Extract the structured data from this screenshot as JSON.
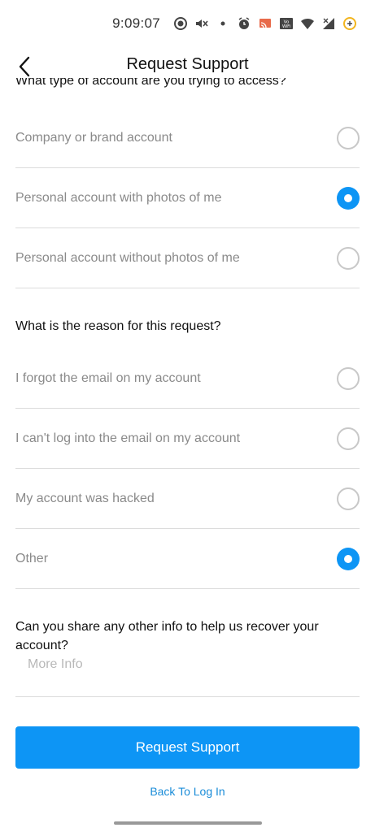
{
  "status_bar": {
    "time": "9:09:07",
    "icons": [
      "record-icon",
      "mute-icon",
      "dot-icon",
      "alarm-icon",
      "cast-icon",
      "vowifi-icon",
      "wifi-icon",
      "signal-icon",
      "battery-icon"
    ],
    "vowifi_text": "Vo WiFi"
  },
  "header": {
    "title": "Request Support"
  },
  "account_type": {
    "question": "What type of account are you trying to access?",
    "options": [
      {
        "label": "Company or brand account",
        "selected": false
      },
      {
        "label": "Personal account with photos of me",
        "selected": true
      },
      {
        "label": "Personal account without photos of me",
        "selected": false
      }
    ]
  },
  "reason": {
    "question": "What is the reason for this request?",
    "options": [
      {
        "label": "I forgot the email on my account",
        "selected": false
      },
      {
        "label": "I can't log into the email on my account",
        "selected": false
      },
      {
        "label": "My account was hacked",
        "selected": false
      },
      {
        "label": "Other",
        "selected": true
      }
    ]
  },
  "other_info": {
    "question": "Can you share any other info to help us recover your account?",
    "placeholder": "More Info"
  },
  "actions": {
    "submit_label": "Request Support",
    "back_link": "Back To Log In"
  },
  "colors": {
    "accent": "#0d95f5",
    "link": "#1a8cd8"
  }
}
